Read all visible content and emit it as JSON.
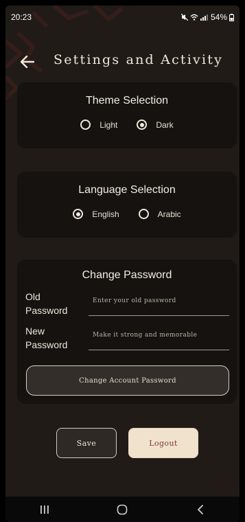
{
  "status_bar": {
    "time": "20:23",
    "battery": "54%",
    "icons": [
      "mute-icon",
      "wifi-icon",
      "signal-icon",
      "battery-icon"
    ]
  },
  "header": {
    "title": "Settings and Activity",
    "back_icon": "back-arrow-icon"
  },
  "theme": {
    "title": "Theme Selection",
    "options": [
      {
        "label": "Light",
        "selected": false
      },
      {
        "label": "Dark",
        "selected": true
      }
    ]
  },
  "language": {
    "title": "Language Selection",
    "options": [
      {
        "label": "English",
        "selected": true
      },
      {
        "label": "Arabic",
        "selected": false
      }
    ]
  },
  "password": {
    "title": "Change Password",
    "old_label": "Old Password",
    "old_placeholder": "Enter your old password",
    "new_label": "New Password",
    "new_placeholder": "Make it strong and memorable",
    "button_label": "Change Account Password"
  },
  "actions": {
    "save_label": "Save",
    "logout_label": "Logout"
  },
  "nav_bar": {
    "icons": [
      "recent-apps-icon",
      "home-icon",
      "back-nav-icon"
    ]
  },
  "colors": {
    "background": "#201b17",
    "card": "#151210",
    "text": "#f1e9dc",
    "logout_bg": "#f1e2cd",
    "logout_text": "#7d3b34"
  }
}
